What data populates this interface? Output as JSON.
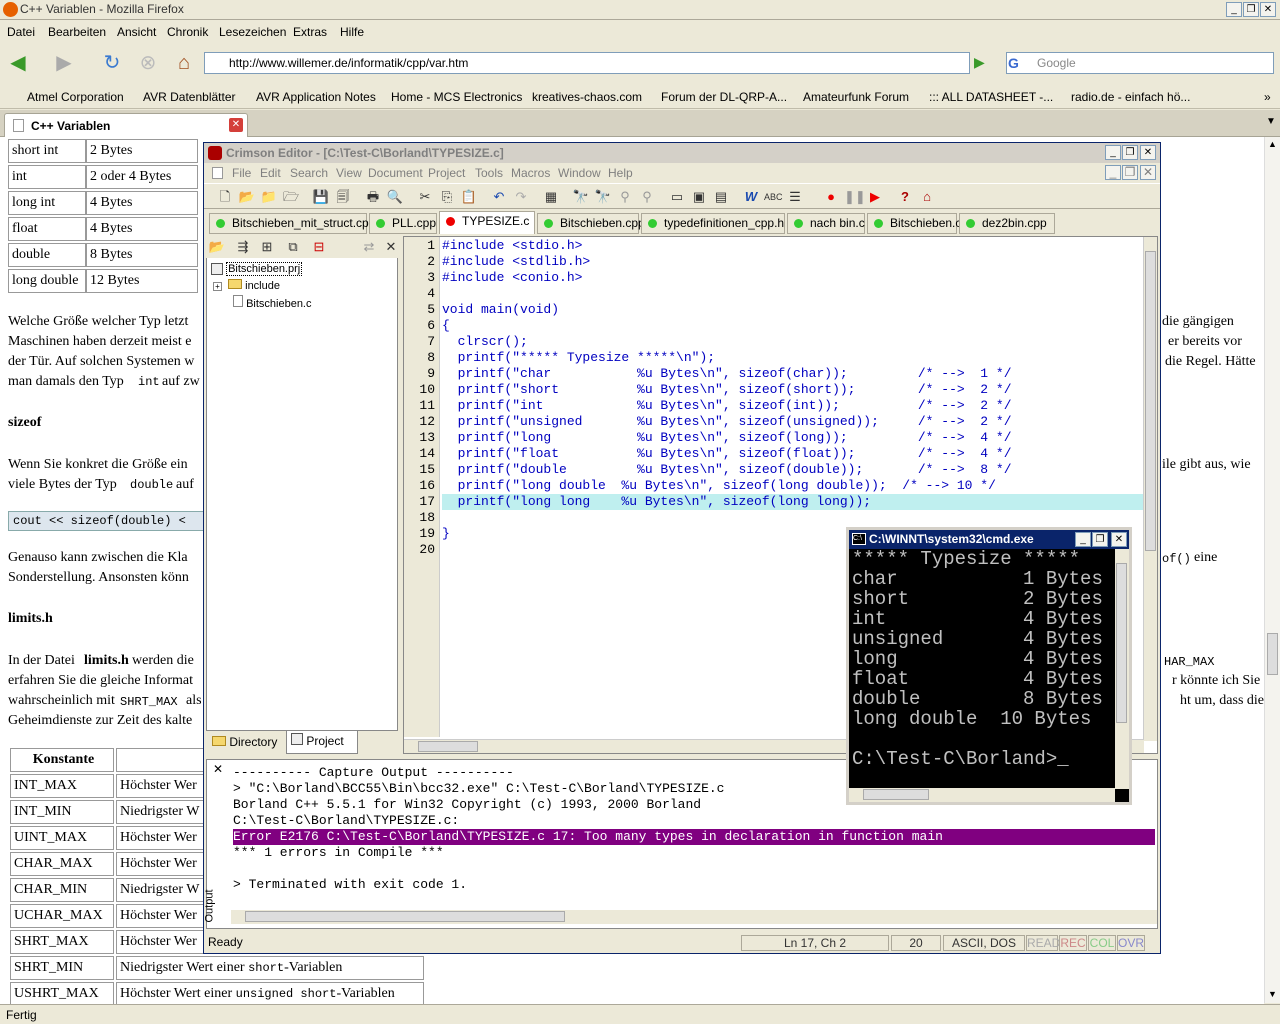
{
  "firefox": {
    "title": "C++ Variablen - Mozilla Firefox",
    "menu": [
      "Datei",
      "Bearbeiten",
      "Ansicht",
      "Chronik",
      "Lesezeichen",
      "Extras",
      "Hilfe"
    ],
    "url": "http://www.willemer.de/informatik/cpp/var.htm",
    "search_placeholder": "Google",
    "bookmarks": [
      "Atmel Corporation",
      "AVR Datenblätter",
      "AVR Application Notes",
      "Home - MCS Electronics",
      "kreatives-chaos.com",
      "Forum der DL-QRP-A...",
      "Amateurfunk Forum",
      "::: ALL DATASHEET -...",
      "radio.de - einfach hö..."
    ],
    "tab_title": "C++ Variablen",
    "status": "Fertig"
  },
  "page": {
    "type_table": [
      {
        "type": "short int",
        "size": "2 Bytes"
      },
      {
        "type": "int",
        "size": "2 oder 4 Bytes"
      },
      {
        "type": "long int",
        "size": "4 Bytes"
      },
      {
        "type": "float",
        "size": "4 Bytes"
      },
      {
        "type": "double",
        "size": "8 Bytes"
      },
      {
        "type": "long double",
        "size": "12 Bytes"
      }
    ],
    "para1_left": [
      "Welche Größe welcher Typ letzt",
      "Maschinen haben derzeit meist e",
      "der Tür. Auf solchen Systemen w",
      "man damals den Typ "
    ],
    "para1_left_code": "int",
    "para1_left_end": " auf zw",
    "para1_right": [
      "die gängigen",
      "er bereits vor",
      "die Regel. Hätte"
    ],
    "h_sizeof": "sizeof",
    "para2_left": [
      "Wenn Sie konkret die Größe ein",
      "viele Bytes der Typ "
    ],
    "para2_code": "double",
    "para2_end": " auf",
    "para2_right": "ile gibt aus, wie",
    "code_box": "cout << sizeof(double) <",
    "para3_left": [
      "Genauso kann zwischen die Kla",
      "Sonderstellung. Ansonsten könn"
    ],
    "para3_right_code": "of()",
    "para3_right": " eine",
    "h_limits": "limits.h",
    "para4_left_a": "In der Datei ",
    "para4_left_b": "limits.h",
    "para4_left_c": " werden die",
    "para4_lines": [
      "erfahren Sie die gleiche Informat",
      "wahrscheinlich mit ",
      "Geheimdienste zur Zeit des kalte"
    ],
    "para4_code": "SHRT_MAX",
    "para4_code_end": " als",
    "para4_right": [
      "HAR_MAX",
      "r könnte ich Sie",
      "ht um, dass die"
    ],
    "const_header": "Konstante",
    "const_table": [
      {
        "name": "INT_MAX",
        "desc": "Höchster Wer"
      },
      {
        "name": "INT_MIN",
        "desc": "Niedrigster W"
      },
      {
        "name": "UINT_MAX",
        "desc": "Höchster Wer"
      },
      {
        "name": "CHAR_MAX",
        "desc": "Höchster Wer"
      },
      {
        "name": "CHAR_MIN",
        "desc": "Niedrigster W"
      },
      {
        "name": "UCHAR_MAX",
        "desc": "Höchster Wer"
      },
      {
        "name": "SHRT_MAX",
        "desc": "Höchster Wer"
      }
    ],
    "shrt_min": {
      "name": "SHRT_MIN",
      "desc_a": "Niedrigster Wert einer ",
      "desc_code": "short",
      "desc_b": "-Variablen"
    },
    "ushrt_max": {
      "name": "USHRT_MAX",
      "desc_a": "Höchster Wert einer ",
      "desc_code": "unsigned short",
      "desc_b": "-Variablen"
    }
  },
  "crimson": {
    "title": "Crimson Editor - [C:\\Test-C\\Borland\\TYPESIZE.c]",
    "menu": [
      "File",
      "Edit",
      "Search",
      "View",
      "Document",
      "Project",
      "Tools",
      "Macros",
      "Window",
      "Help"
    ],
    "tabs": [
      "Bitschieben_mit_struct.cpp",
      "PLL.cpp",
      "TYPESIZE.c",
      "Bitschieben.cpp",
      "typedefinitionen_cpp.h",
      "nach bin.c",
      "Bitschieben.c",
      "dez2bin.cpp"
    ],
    "active_tab": "TYPESIZE.c",
    "tree": {
      "project": "Bitschieben.prj",
      "folder": "include",
      "file": "Bitschieben.c"
    },
    "side_tabs": [
      "Directory",
      "Project"
    ],
    "code_lines": [
      "#include <stdio.h>",
      "#include <stdlib.h>",
      "#include <conio.h>",
      "",
      "void main(void)",
      "{",
      "  clrscr();",
      "  printf(\"***** Typesize *****\\n\");",
      "  printf(\"char           %u Bytes\\n\", sizeof(char));         /* -->  1 */",
      "  printf(\"short          %u Bytes\\n\", sizeof(short));        /* -->  2 */",
      "  printf(\"int            %u Bytes\\n\", sizeof(int));          /* -->  2 */",
      "  printf(\"unsigned       %u Bytes\\n\", sizeof(unsigned));     /* -->  2 */",
      "  printf(\"long           %u Bytes\\n\", sizeof(long));         /* -->  4 */",
      "  printf(\"float          %u Bytes\\n\", sizeof(float));        /* -->  4 */",
      "  printf(\"double         %u Bytes\\n\", sizeof(double));       /* -->  8 */",
      "  printf(\"long double  %u Bytes\\n\", sizeof(long double));  /* --> 10 */",
      "  printf(\"long long    %u Bytes\\n\", sizeof(long long));",
      "",
      "}",
      ""
    ],
    "highlighted_line": 17,
    "output_lines": [
      "---------- Capture Output ----------",
      "> \"C:\\Borland\\BCC55\\Bin\\bcc32.exe\" C:\\Test-C\\Borland\\TYPESIZE.c",
      "Borland C++ 5.5.1 for Win32 Copyright (c) 1993, 2000 Borland",
      "C:\\Test-C\\Borland\\TYPESIZE.c:",
      "Error E2176 C:\\Test-C\\Borland\\TYPESIZE.c 17: Too many types in declaration in function main",
      "*** 1 errors in Compile ***",
      "",
      "> Terminated with exit code 1."
    ],
    "output_label": "Output",
    "status": {
      "ready": "Ready",
      "pos": "Ln 17, Ch 2",
      "lines": "20",
      "enc": "ASCII, DOS",
      "read": "READ",
      "rec": "REC",
      "col": "COL",
      "ovr": "OVR"
    }
  },
  "cmd": {
    "title": "C:\\WINNT\\system32\\cmd.exe",
    "lines": [
      "***** Typesize *****",
      "char           1 Bytes",
      "short          2 Bytes",
      "int            4 Bytes",
      "unsigned       4 Bytes",
      "long           4 Bytes",
      "float          4 Bytes",
      "double         8 Bytes",
      "long double  10 Bytes",
      "",
      "C:\\Test-C\\Borland>_"
    ]
  }
}
